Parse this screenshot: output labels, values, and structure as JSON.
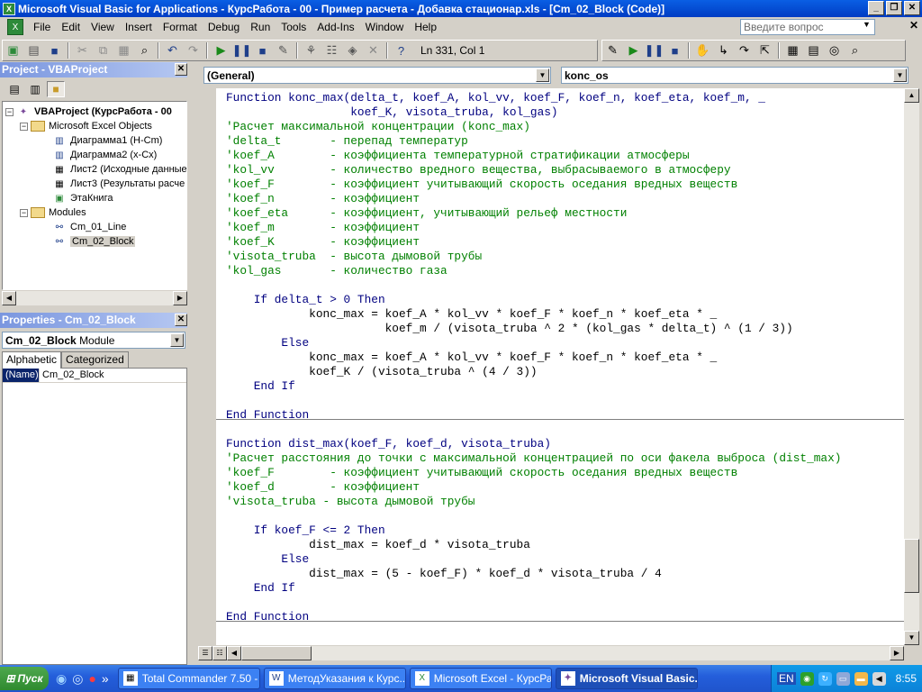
{
  "window": {
    "title": "Microsoft Visual Basic for Applications - КурсРабота - 00 - Пример расчета - Добавка стационар.xls - [Cm_02_Block (Code)]"
  },
  "menu": {
    "items": [
      "File",
      "Edit",
      "View",
      "Insert",
      "Format",
      "Debug",
      "Run",
      "Tools",
      "Add-Ins",
      "Window",
      "Help"
    ]
  },
  "ask": {
    "placeholder": "Введите вопрос"
  },
  "toolbar": {
    "position": "Ln 331, Col 1"
  },
  "project": {
    "title": "Project - VBAProject",
    "root": "VBAProject (КурсРабота - 00",
    "objects_folder": "Microsoft Excel Objects",
    "objects": [
      "Диаграмма1 (H-Cm)",
      "Диаграмма2 (x-Cx)",
      "Лист2 (Исходные данные",
      "Лист3 (Результаты расче",
      "ЭтаКнига"
    ],
    "modules_folder": "Modules",
    "modules": [
      "Cm_01_Line",
      "Cm_02_Block"
    ]
  },
  "properties": {
    "title": "Properties - Cm_02_Block",
    "object_name": "Cm_02_Block",
    "object_type": "Module",
    "tabs": [
      "Alphabetic",
      "Categorized"
    ],
    "prop_name": "(Name)",
    "prop_value": "Cm_02_Block"
  },
  "editor": {
    "object_combo": "(General)",
    "proc_combo": "konc_os",
    "lines": [
      {
        "t": "Function konc_max(delta_t, koef_A, kol_vv, koef_F, koef_n, koef_eta, koef_m, _",
        "c": "kw"
      },
      {
        "t": "                  koef_K, visota_truba, kol_gas)",
        "c": "kw"
      },
      {
        "t": "'Расчет максимальной концентрации (konc_max)",
        "c": "cm"
      },
      {
        "t": "'delta_t       - перепад температур",
        "c": "cm"
      },
      {
        "t": "'koef_A        - коэффициента температурной стратификации атмосферы",
        "c": "cm"
      },
      {
        "t": "'kol_vv        - количество вредного вещества, выбрасываемого в атмосферу",
        "c": "cm"
      },
      {
        "t": "'koef_F        - коэффициент учитывающий скорость оседания вредных веществ",
        "c": "cm"
      },
      {
        "t": "'koef_n        - коэффициент",
        "c": "cm"
      },
      {
        "t": "'koef_eta      - коэффициент, учитывающий рельеф местности",
        "c": "cm"
      },
      {
        "t": "'koef_m        - коэффициент",
        "c": "cm"
      },
      {
        "t": "'koef_K        - коэффициент",
        "c": "cm"
      },
      {
        "t": "'visota_truba  - высота дымовой трубы",
        "c": "cm"
      },
      {
        "t": "'kol_gas       - количество газа",
        "c": "cm"
      },
      {
        "t": "",
        "c": ""
      },
      {
        "t": "    If delta_t > 0 Then",
        "c": "kw"
      },
      {
        "t": "            konc_max = koef_A * kol_vv * koef_F * koef_n * koef_eta * _",
        "c": ""
      },
      {
        "t": "                       koef_m / (visota_truba ^ 2 * (kol_gas * delta_t) ^ (1 / 3))",
        "c": ""
      },
      {
        "t": "        Else",
        "c": "kw"
      },
      {
        "t": "            konc_max = koef_A * kol_vv * koef_F * koef_n * koef_eta * _",
        "c": ""
      },
      {
        "t": "            koef_K / (visota_truba ^ (4 / 3))",
        "c": ""
      },
      {
        "t": "    End If",
        "c": "kw"
      },
      {
        "t": "",
        "c": ""
      },
      {
        "t": "End Function",
        "c": "kw"
      },
      {
        "t": "",
        "c": ""
      },
      {
        "t": "Function dist_max(koef_F, koef_d, visota_truba)",
        "c": "kw"
      },
      {
        "t": "'Расчет расстояния до точки с максимальной концентрацией по оси факела выброса (dist_max)",
        "c": "cm"
      },
      {
        "t": "'koef_F        - коэффициент учитывающий скорость оседания вредных веществ",
        "c": "cm"
      },
      {
        "t": "'koef_d        - коэффициент",
        "c": "cm"
      },
      {
        "t": "'visota_truba - высота дымовой трубы",
        "c": "cm"
      },
      {
        "t": "",
        "c": ""
      },
      {
        "t": "    If koef_F <= 2 Then",
        "c": "kw"
      },
      {
        "t": "            dist_max = koef_d * visota_truba",
        "c": ""
      },
      {
        "t": "        Else",
        "c": "kw"
      },
      {
        "t": "            dist_max = (5 - koef_F) * koef_d * visota_truba / 4",
        "c": ""
      },
      {
        "t": "    End If",
        "c": "kw"
      },
      {
        "t": "",
        "c": ""
      },
      {
        "t": "End Function",
        "c": "kw"
      }
    ]
  },
  "taskbar": {
    "start": "Пуск",
    "tasks": [
      "Total Commander 7.50 - ...",
      "МетодУказания к Курс...",
      "Microsoft Excel - КурсРа...",
      "Microsoft Visual Basic..."
    ],
    "lang": "EN",
    "clock": "8:55"
  }
}
